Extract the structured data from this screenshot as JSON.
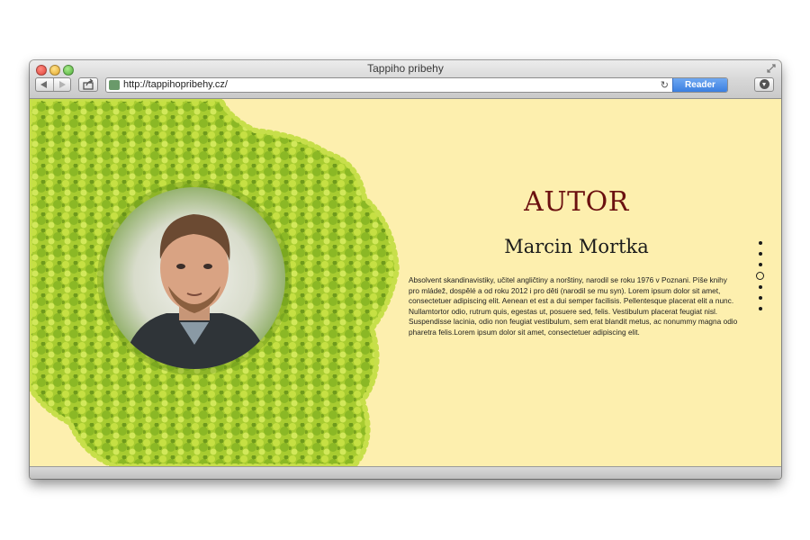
{
  "window": {
    "title": "Tappiho pribehy"
  },
  "toolbar": {
    "url": "http://tappihopribehy.cz/",
    "reader_label": "Reader"
  },
  "icons": {
    "back": "back-arrow-icon",
    "forward": "forward-arrow-icon",
    "share": "share-icon",
    "reload": "reload-icon",
    "download": "download-icon",
    "favicon": "site-favicon-icon"
  },
  "page": {
    "section_title": "AUTOR",
    "author_name": "Marcin Mortka",
    "bio": "Absolvent skandinavistiky, učitel angličtiny a norštiny, narodil se roku 1976 v Poznani. Píše knihy pro mládež, dospělé a od roku 2012 i pro děti (narodil se mu syn). Lorem ipsum dolor sit amet, consectetuer adipiscing elit. Aenean et est a dui semper facilisis. Pellentesque placerat elit a nunc. Nullamtortor odio, rutrum quis, egestas ut, posuere sed, felis. Vestibulum placerat feugiat nisl. Suspendisse lacinia, odio non feugiat vestibulum, sem erat blandit metus, ac nonummy magna odio pharetra felis.Lorem ipsum dolor sit amet, consectetuer adipiscing elit."
  },
  "colors": {
    "page_background": "#fdefae",
    "title_color": "#6b1010",
    "moss_green": "#9cc62b",
    "reader_blue": "#3b7fe0"
  },
  "pagination": {
    "count": 7,
    "active_index": 3
  }
}
